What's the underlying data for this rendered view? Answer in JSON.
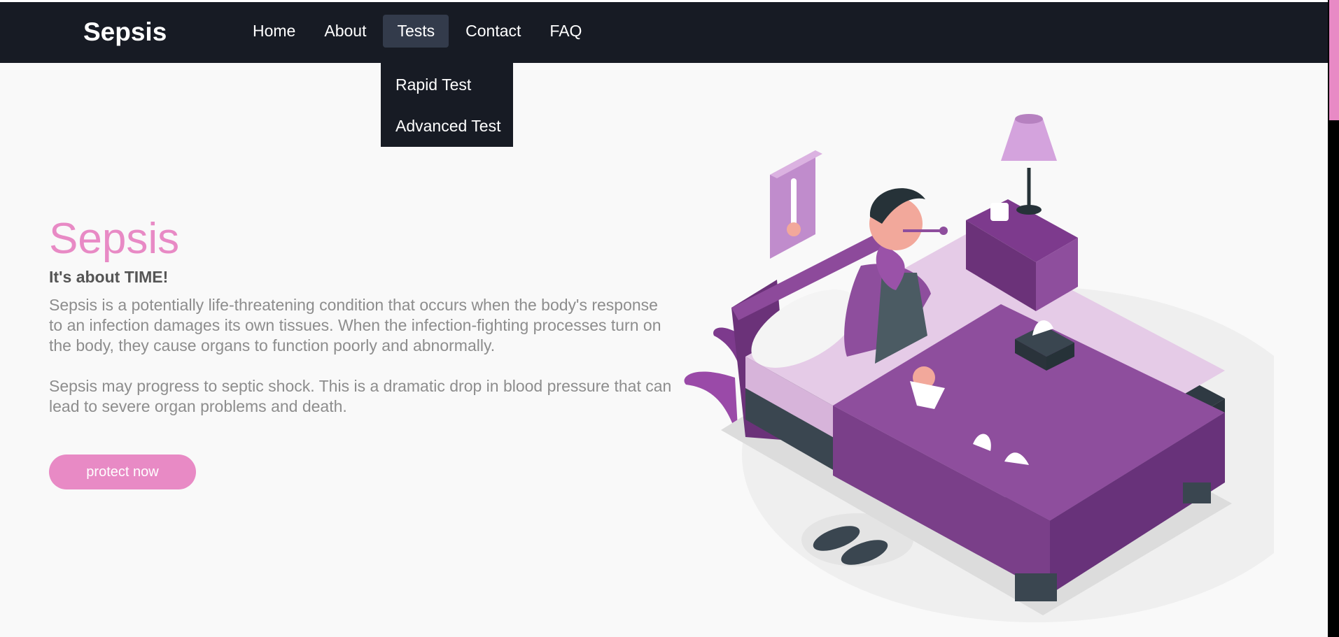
{
  "brand": "Sepsis",
  "nav": [
    {
      "label": "Home"
    },
    {
      "label": "About"
    },
    {
      "label": "Tests"
    },
    {
      "label": "Contact"
    },
    {
      "label": "FAQ"
    }
  ],
  "dropdown": [
    {
      "label": "Rapid Test"
    },
    {
      "label": "Advanced Test"
    }
  ],
  "hero": {
    "title": "Sepsis",
    "subtitle": "It's about TIME!",
    "p1": "Sepsis is a potentially life-threatening condition that occurs when the body's response to an infection damages its own tissues. When the infection-fighting processes turn on the body, they cause organs to function poorly and abnormally.",
    "p2": "Sepsis may progress to septic shock. This is a dramatic drop in blood pressure that can lead to severe organ problems and death.",
    "cta": "protect now"
  },
  "colors": {
    "accent": "#e88ac5",
    "nav_bg": "#171b24",
    "nav_active": "#333b4b",
    "purple": "#8e4e9d"
  },
  "scroll": {
    "position": 0.0
  }
}
